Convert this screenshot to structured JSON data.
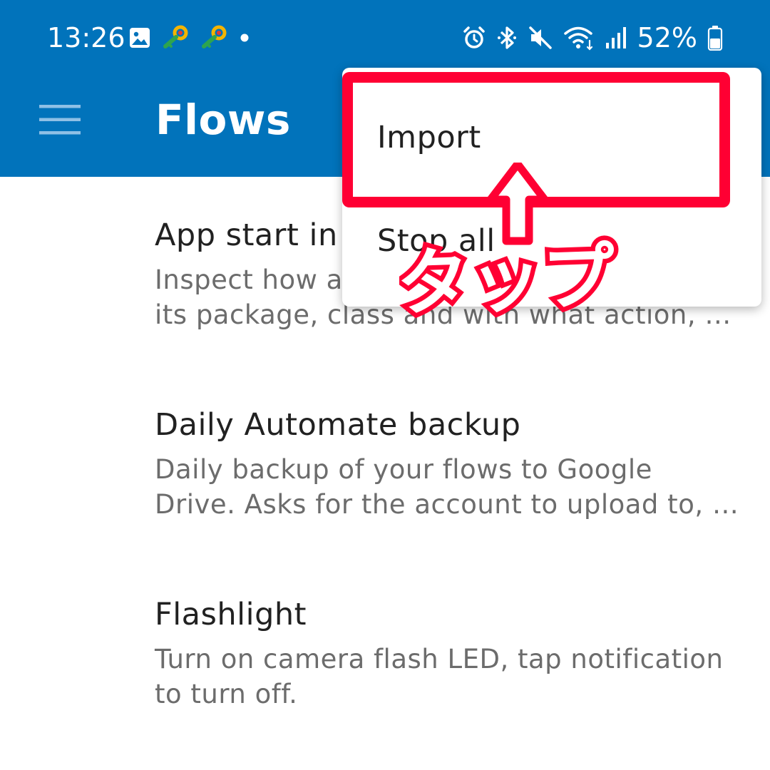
{
  "status_bar": {
    "time": "13:26",
    "battery_percent": "52%",
    "left_icons": [
      "gallery-icon",
      "key-icon",
      "key-icon",
      "dot-icon"
    ],
    "right_icons": [
      "alarm-icon",
      "bluetooth-icon",
      "mute-icon",
      "wifi-icon",
      "signal-icon",
      "battery-icon"
    ]
  },
  "toolbar": {
    "title": "Flows",
    "menu_icon": "hamburger-menu-icon"
  },
  "flows": [
    {
      "title": "App start in",
      "description": "Inspect how a\nits package, class and with what action, …"
    },
    {
      "title": "Daily Automate backup",
      "description": "Daily backup of your flows to Google\nDrive. Asks for the account to upload to, …"
    },
    {
      "title": "Flashlight",
      "description": "Turn on camera flash LED, tap notification\nto turn off."
    }
  ],
  "popup_menu": {
    "items": [
      {
        "label": "Import"
      },
      {
        "label": "Stop all"
      }
    ]
  },
  "annotation": {
    "text": "タップ",
    "color": "#ff0033",
    "arrow": "up-arrow"
  },
  "colors": {
    "primary": "#0173bb",
    "highlight": "#ff0033",
    "title_text": "#212121",
    "description_text": "#6c6c6c"
  }
}
